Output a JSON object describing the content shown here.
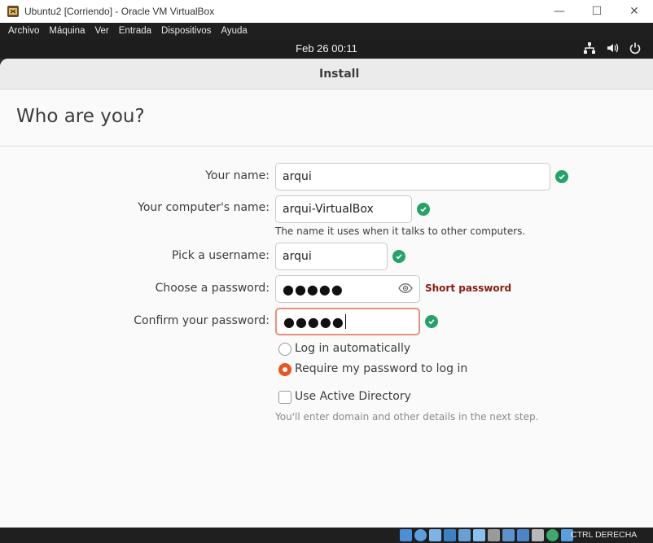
{
  "window": {
    "title": "Ubuntu2 [Corriendo] - Oracle VM VirtualBox",
    "minimize": "—",
    "maximize": "☐",
    "close": "✕"
  },
  "vbox_menu": [
    "Archivo",
    "Máquina",
    "Ver",
    "Entrada",
    "Dispositivos",
    "Ayuda"
  ],
  "topbar": {
    "clock": "Feb 26  00:11"
  },
  "installer": {
    "title": "Install",
    "heading": "Who are you?",
    "fields": {
      "your_name": {
        "label": "Your name:",
        "value": "arqui"
      },
      "computer_name": {
        "label": "Your computer's name:",
        "value": "arqui-VirtualBox",
        "hint": "The name it uses when it talks to other computers."
      },
      "username": {
        "label": "Pick a username:",
        "value": "arqui"
      },
      "password": {
        "label": "Choose a password:",
        "value": "●●●●●",
        "strength": "Short password"
      },
      "confirm_password": {
        "label": "Confirm your password:",
        "value": "●●●●●"
      }
    },
    "login": {
      "auto": "Log in automatically",
      "require": "Require my password to log in",
      "selected": "require"
    },
    "active_directory": {
      "label": "Use Active Directory",
      "checked": false,
      "hint": "You'll enter domain and other details in the next step."
    },
    "colors": {
      "valid": "#26a269",
      "accent": "#e95420",
      "warning": "#8a1b10"
    }
  },
  "statusbar": {
    "host_key": "CTRL DERECHA"
  }
}
